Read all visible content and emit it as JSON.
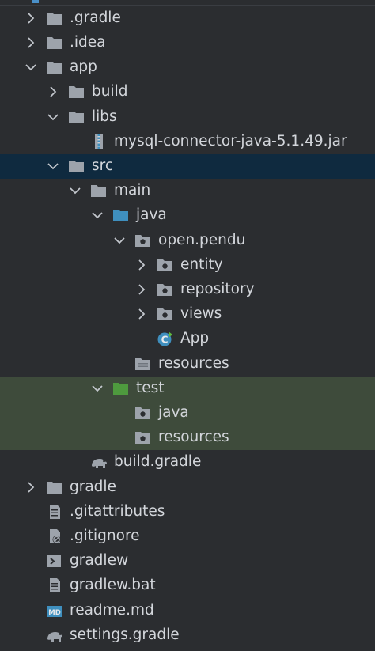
{
  "colors": {
    "background": "#2b2d30",
    "selected_row": "#0f2a3f",
    "test_highlight": "#3e4b3b",
    "folder_gray": "#9da3ab",
    "folder_source": "#3f8fbe",
    "folder_test": "#4e9a3e",
    "text": "#d3d6db"
  },
  "tree": {
    "items": [
      {
        "label": ".gradle",
        "icon": "folder-icon",
        "expand": "collapsed"
      },
      {
        "label": ".idea",
        "icon": "folder-icon",
        "expand": "collapsed"
      },
      {
        "label": "app",
        "icon": "folder-icon",
        "expand": "expanded"
      },
      {
        "label": "build",
        "icon": "folder-icon",
        "expand": "collapsed"
      },
      {
        "label": "libs",
        "icon": "folder-icon",
        "expand": "expanded"
      },
      {
        "label": "mysql-connector-java-5.1.49.jar",
        "icon": "jar-archive-icon",
        "expand": "none"
      },
      {
        "label": "src",
        "icon": "folder-icon",
        "expand": "expanded",
        "selected": true
      },
      {
        "label": "main",
        "icon": "folder-icon",
        "expand": "expanded"
      },
      {
        "label": "java",
        "icon": "source-root-folder-icon",
        "expand": "expanded"
      },
      {
        "label": "open.pendu",
        "icon": "package-icon",
        "expand": "expanded"
      },
      {
        "label": "entity",
        "icon": "package-icon",
        "expand": "collapsed"
      },
      {
        "label": "repository",
        "icon": "package-icon",
        "expand": "collapsed"
      },
      {
        "label": "views",
        "icon": "package-icon",
        "expand": "collapsed"
      },
      {
        "label": "App",
        "icon": "java-class-icon",
        "expand": "none"
      },
      {
        "label": "resources",
        "icon": "resources-folder-icon",
        "expand": "none"
      },
      {
        "label": "test",
        "icon": "test-folder-icon",
        "expand": "expanded",
        "highlighted": true
      },
      {
        "label": "java",
        "icon": "package-icon",
        "expand": "none",
        "highlighted": true
      },
      {
        "label": "resources",
        "icon": "package-icon",
        "expand": "none",
        "highlighted": true
      },
      {
        "label": "build.gradle",
        "icon": "gradle-elephant-icon",
        "expand": "none"
      },
      {
        "label": "gradle",
        "icon": "folder-icon",
        "expand": "collapsed"
      },
      {
        "label": ".gitattributes",
        "icon": "text-file-icon",
        "expand": "none"
      },
      {
        "label": ".gitignore",
        "icon": "ignore-file-icon",
        "expand": "none"
      },
      {
        "label": "gradlew",
        "icon": "shell-script-icon",
        "expand": "none"
      },
      {
        "label": "gradlew.bat",
        "icon": "text-file-icon",
        "expand": "none"
      },
      {
        "label": "readme.md",
        "icon": "markdown-file-icon",
        "expand": "none"
      },
      {
        "label": "settings.gradle",
        "icon": "gradle-elephant-icon",
        "expand": "none"
      }
    ]
  }
}
